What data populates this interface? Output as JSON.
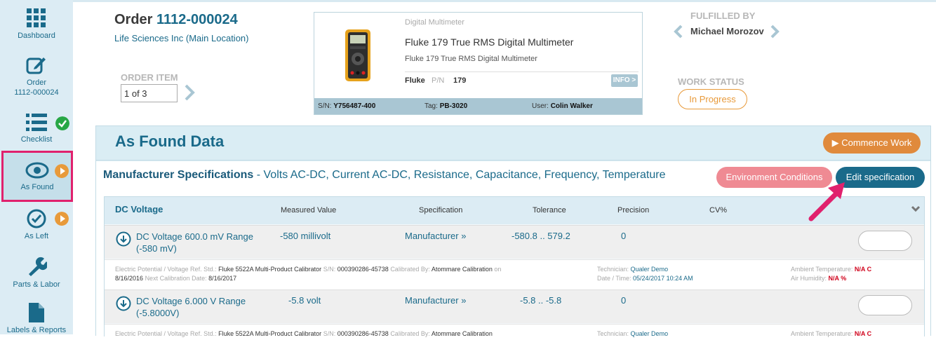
{
  "sidebar": {
    "items": [
      {
        "label": "Dashboard",
        "icon": "grid-icon"
      },
      {
        "label": "Order\n1112-000024",
        "label_line1": "Order",
        "label_line2": "1112-000024",
        "icon": "edit-icon"
      },
      {
        "label": "Checklist",
        "icon": "list-icon",
        "badge": "check"
      },
      {
        "label": "As Found",
        "icon": "eye-icon",
        "badge": "play"
      },
      {
        "label": "As Left",
        "icon": "check-circle-icon",
        "badge": "play"
      },
      {
        "label": "Parts & Labor",
        "icon": "wrench-icon"
      },
      {
        "label": "Labels & Reports",
        "icon": "document-icon"
      }
    ]
  },
  "order": {
    "prefix": "Order ",
    "number": "1112-000024",
    "customer": "Life Sciences Inc (Main Location)",
    "item_label": "ORDER ITEM",
    "item_value": "1 of 3"
  },
  "product": {
    "category": "Digital Multimeter",
    "name": "Fluke 179 True RMS Digital Multimeter",
    "description": "Fluke 179 True RMS Digital Multimeter",
    "brand": "Fluke",
    "pn_label": "P/N",
    "pn": "179",
    "info_button": "INFO >",
    "sn_label": "S/N:",
    "sn": "Y756487-400",
    "tag_label": "Tag:",
    "tag": "PB-3020",
    "user_label": "User:",
    "user": "Colin Walker"
  },
  "fulfilled": {
    "label": "FULFILLED BY",
    "name": "Michael Morozov"
  },
  "work_status": {
    "label": "WORK STATUS",
    "value": "In Progress"
  },
  "panel": {
    "title": "As Found Data",
    "commence_button": "▶ Commence Work",
    "spec_title": "Manufacturer Specifications",
    "spec_sub": " - Volts AC-DC, Current AC-DC, Resistance, Capacitance, Frequency, Temperature",
    "env_button": "Environment Conditions",
    "edit_button": "Edit specification"
  },
  "grid": {
    "title": "DC Voltage",
    "columns": [
      "Measured Value",
      "Specification",
      "Tolerance",
      "Precision",
      "CV%"
    ],
    "rows": [
      {
        "name_line1": "DC Voltage 600.0 mV Range",
        "name_line2": "(-580 mV)",
        "measured": "-580 millivolt",
        "spec": "Manufacturer »",
        "tolerance": "-580.8 .. 579.2",
        "precision": "0"
      },
      {
        "name_line1": "DC Voltage 6.000 V Range",
        "name_line2": "(-5.8000V)",
        "measured": "-5.8 volt",
        "spec": "Manufacturer »",
        "tolerance": "-5.8 .. -5.8",
        "precision": "0"
      }
    ],
    "meta": {
      "ref_label": "Electric Potential / Voltage Ref. Std.:",
      "ref_value": "Fluke 5522A Multi-Product Calibrator",
      "sn_label": "S/N:",
      "sn_value": "000390286-45738",
      "cal_by_label": "Calibrated By:",
      "cal_by_value": "Atommare Calibration",
      "on_label": "on",
      "cal_date": "8/16/2016",
      "next_label": "Next Calibration Date:",
      "next_date": "8/16/2017",
      "tech_label": "Technician:",
      "tech_value": "Qualer Demo",
      "dt_label": "Date / Time:",
      "dt_value": "05/24/2017 10:24 AM",
      "temp_label": "Ambient Temperature:",
      "temp_value": "N/A C",
      "hum_label": "Air Humidity:",
      "hum_value": "N/A %",
      "tech2_label": "Technician:",
      "tech2_value": "Qualer Demo",
      "temp2_label": "Ambient Temperature:",
      "temp2_value": "N/A C"
    }
  },
  "colors": {
    "accent": "#1a6a8a",
    "sidebar_bg": "#dcecf4",
    "highlight": "#e0216d",
    "orange": "#e08a3c"
  }
}
